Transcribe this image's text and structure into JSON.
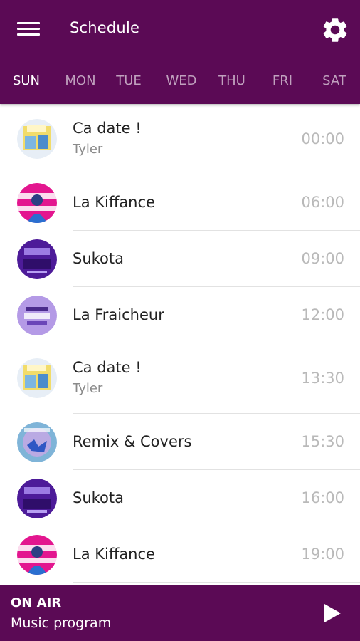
{
  "header": {
    "title": "Schedule",
    "background": "#5b0a55"
  },
  "days": [
    {
      "label": "SUN",
      "active": true
    },
    {
      "label": "MON",
      "active": false
    },
    {
      "label": "TUE",
      "active": false
    },
    {
      "label": "WED",
      "active": false
    },
    {
      "label": "THU",
      "active": false
    },
    {
      "label": "FRI",
      "active": false
    },
    {
      "label": "SAT",
      "active": false
    }
  ],
  "schedule": [
    {
      "title": "Ca date !",
      "host": "Tyler",
      "time": "00:00"
    },
    {
      "title": "La Kiffance",
      "host": "",
      "time": "06:00"
    },
    {
      "title": "Sukota",
      "host": "",
      "time": "09:00"
    },
    {
      "title": "La Fraicheur",
      "host": "",
      "time": "12:00"
    },
    {
      "title": "Ca date !",
      "host": "Tyler",
      "time": "13:30"
    },
    {
      "title": "Remix & Covers",
      "host": "",
      "time": "15:30"
    },
    {
      "title": "Sukota",
      "host": "",
      "time": "16:00"
    },
    {
      "title": "La Kiffance",
      "host": "",
      "time": "19:00"
    }
  ],
  "player": {
    "status": "ON AIR",
    "program": "Music program"
  }
}
